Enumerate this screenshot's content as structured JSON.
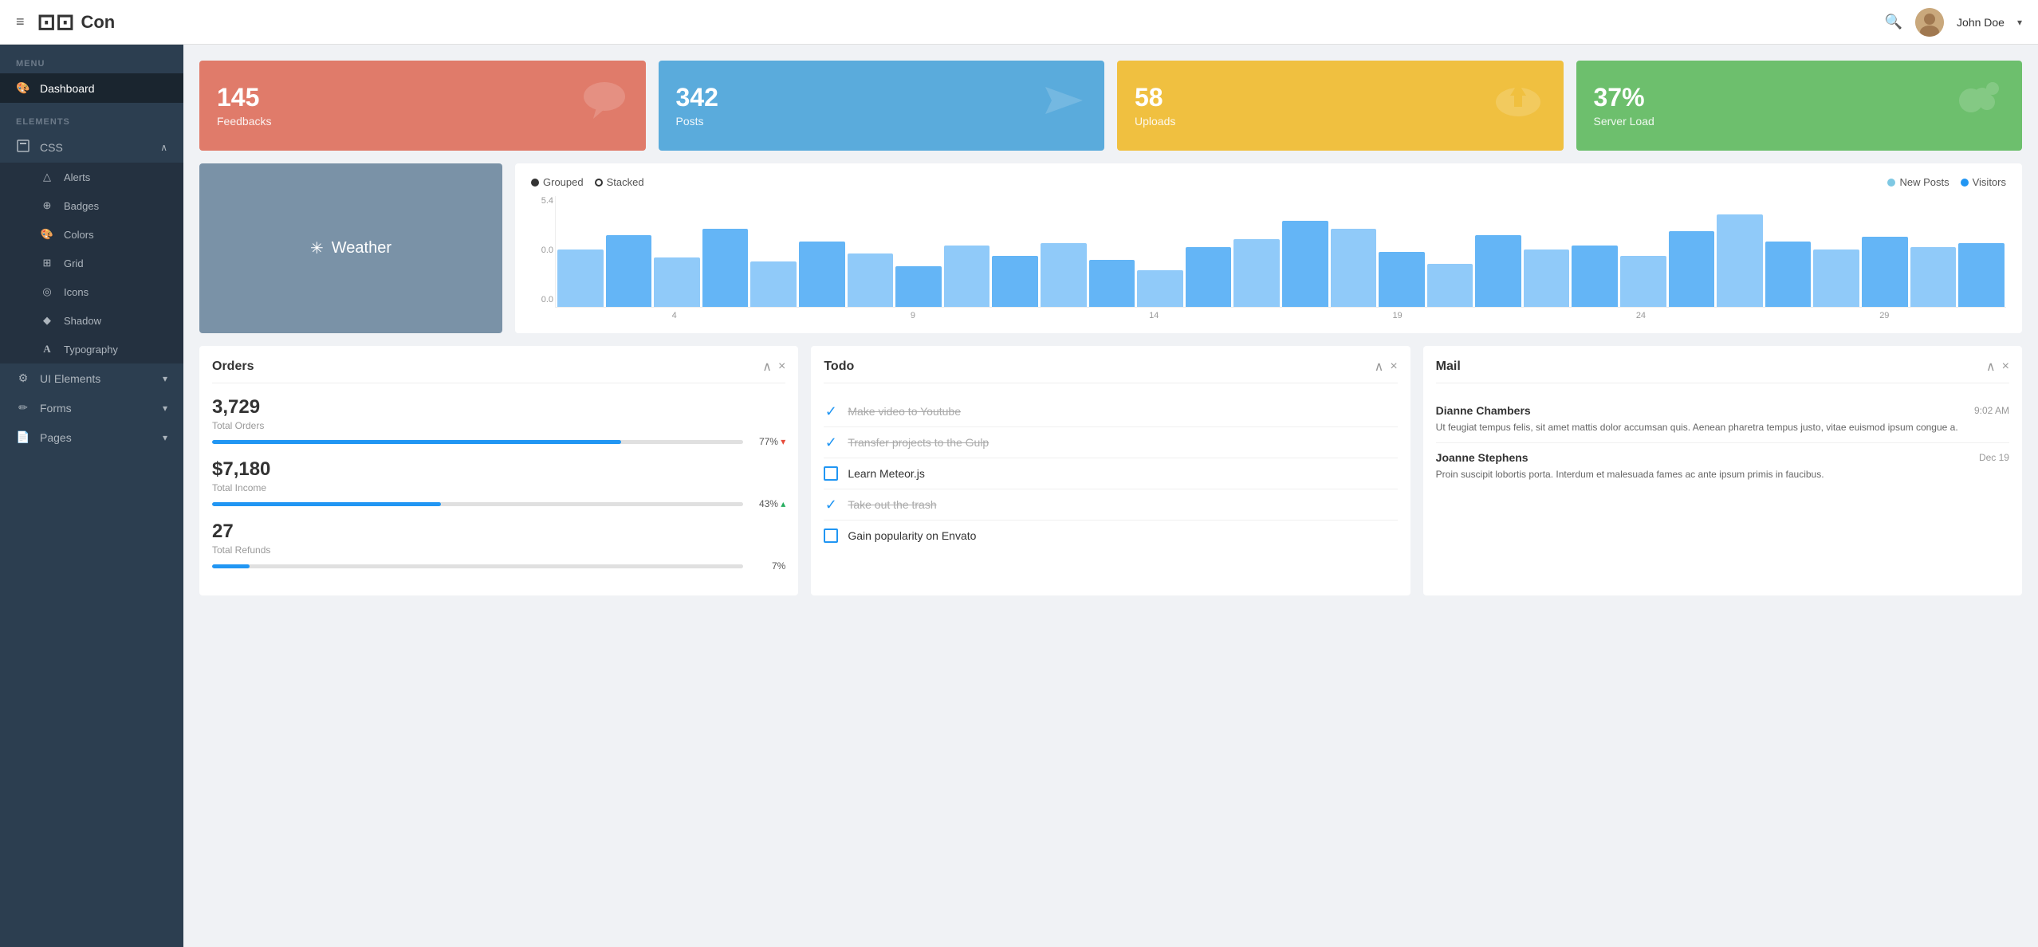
{
  "topnav": {
    "logo_icon": "⬜",
    "logo_text": "Con",
    "username": "John Doe"
  },
  "sidebar": {
    "menu_label": "MENU",
    "elements_label": "ELEMENTS",
    "items": [
      {
        "id": "dashboard",
        "label": "Dashboard",
        "icon": "🎨"
      },
      {
        "id": "css",
        "label": "CSS",
        "icon": "◻",
        "expanded": true
      },
      {
        "id": "alerts",
        "label": "Alerts",
        "icon": "△",
        "sub": true
      },
      {
        "id": "badges",
        "label": "Badges",
        "icon": "⊕",
        "sub": true
      },
      {
        "id": "colors",
        "label": "Colors",
        "icon": "🎨",
        "sub": true
      },
      {
        "id": "grid",
        "label": "Grid",
        "icon": "⊞",
        "sub": true
      },
      {
        "id": "icons",
        "label": "Icons",
        "icon": "◎",
        "sub": true
      },
      {
        "id": "shadow",
        "label": "Shadow",
        "icon": "◆",
        "sub": true
      },
      {
        "id": "typography",
        "label": "Typography",
        "icon": "A",
        "sub": true
      },
      {
        "id": "ui-elements",
        "label": "UI Elements",
        "icon": "⚙",
        "arrow": "▾"
      },
      {
        "id": "forms",
        "label": "Forms",
        "icon": "✏",
        "arrow": "▾"
      },
      {
        "id": "pages",
        "label": "Pages",
        "icon": "📄",
        "arrow": "▾"
      }
    ]
  },
  "stat_cards": [
    {
      "id": "feedbacks",
      "value": "145",
      "label": "Feedbacks",
      "icon": "💬",
      "color": "card-red"
    },
    {
      "id": "posts",
      "value": "342",
      "label": "Posts",
      "icon": "✈",
      "color": "card-blue"
    },
    {
      "id": "uploads",
      "value": "58",
      "label": "Uploads",
      "icon": "☁",
      "color": "card-yellow"
    },
    {
      "id": "server-load",
      "value": "37%",
      "label": "Server Load",
      "icon": "⬤",
      "color": "card-green"
    }
  ],
  "weather": {
    "label": "Weather"
  },
  "chart": {
    "legend_grouped": "Grouped",
    "legend_stacked": "Stacked",
    "legend_new_posts": "New Posts",
    "legend_visitors": "Visitors",
    "y_max": "5.4",
    "y_mid": "0.0",
    "y_min": "0.0",
    "x_labels": [
      "4",
      "9",
      "14",
      "19",
      "24",
      "29"
    ],
    "bars": [
      2.8,
      3.5,
      2.4,
      3.8,
      2.2,
      3.2,
      2.6,
      2.0,
      3.0,
      2.5,
      3.1,
      2.3,
      1.8,
      2.9,
      3.3,
      4.2,
      3.8,
      2.7,
      2.1,
      3.5,
      2.8,
      3.0,
      2.5,
      3.7,
      4.5,
      3.2,
      2.8,
      3.4,
      2.9,
      3.1
    ]
  },
  "orders": {
    "title": "Orders",
    "metrics": [
      {
        "value": "3,729",
        "label": "Total Orders",
        "pct": 77,
        "pct_label": "77%",
        "trend": "down"
      },
      {
        "value": "$7,180",
        "label": "Total Income",
        "pct": 43,
        "pct_label": "43%",
        "trend": "up"
      },
      {
        "value": "27",
        "label": "Total Refunds",
        "pct": 7,
        "pct_label": "7%",
        "trend": null
      }
    ]
  },
  "todo": {
    "title": "Todo",
    "items": [
      {
        "text": "Make video to Youtube",
        "done": true
      },
      {
        "text": "Transfer projects to the Gulp",
        "done": true
      },
      {
        "text": "Learn Meteor.js",
        "done": false
      },
      {
        "text": "Take out the trash",
        "done": true
      },
      {
        "text": "Gain popularity on Envato",
        "done": false
      }
    ]
  },
  "mail": {
    "title": "Mail",
    "items": [
      {
        "sender": "Dianne Chambers",
        "time": "9:02 AM",
        "body": "Ut feugiat tempus felis, sit amet mattis dolor accumsan quis. Aenean pharetra tempus justo, vitae euismod ipsum congue a."
      },
      {
        "sender": "Joanne Stephens",
        "time": "Dec 19",
        "body": "Proin suscipit lobortis porta. Interdum et malesuada fames ac ante ipsum primis in faucibus."
      }
    ]
  }
}
